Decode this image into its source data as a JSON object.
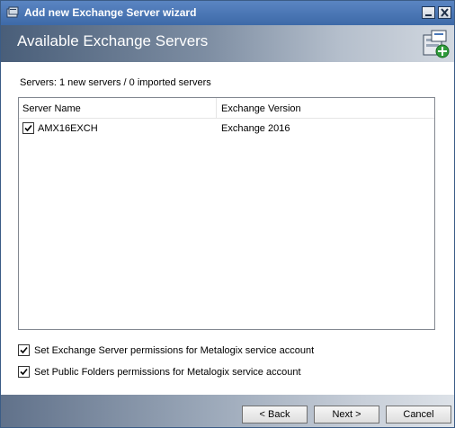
{
  "window": {
    "title": "Add new Exchange Server wizard"
  },
  "banner": {
    "heading": "Available Exchange Servers"
  },
  "summary": "Servers: 1 new servers / 0 imported servers",
  "server_list": {
    "columns": [
      "Server Name",
      "Exchange Version"
    ],
    "rows": [
      {
        "checked": true,
        "name": "AMX16EXCH",
        "version": "Exchange 2016"
      }
    ]
  },
  "options": [
    {
      "checked": true,
      "label": "Set Exchange Server permissions for Metalogix service account"
    },
    {
      "checked": true,
      "label": "Set Public Folders permissions for Metalogix service account"
    }
  ],
  "buttons": {
    "back": "< Back",
    "next": "Next >",
    "cancel": "Cancel"
  },
  "colors": {
    "title_bar": "#4a78b8",
    "banner_dark": "#495e79",
    "footer_dark": "#60718a"
  },
  "icons": [
    "app-icon",
    "minimize-icon",
    "close-icon",
    "exchange-server-add-icon",
    "checkmark-icon"
  ]
}
